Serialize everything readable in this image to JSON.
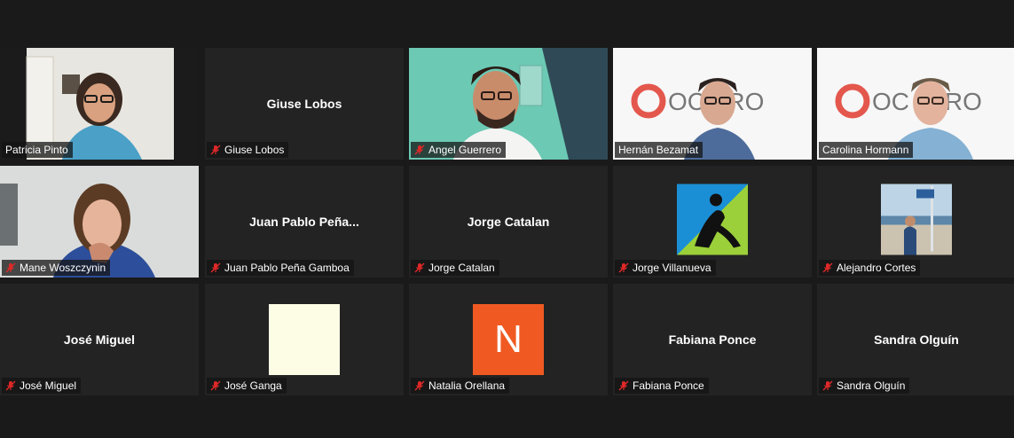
{
  "participants": [
    {
      "name": "Patricia Pinto",
      "muted": false,
      "display": "video"
    },
    {
      "name": "Giuse Lobos",
      "center": "Giuse Lobos",
      "muted": true
    },
    {
      "name": "Angel Guerrero",
      "muted": true,
      "display": "video"
    },
    {
      "name": "Hernán Bezamat",
      "muted": false,
      "display": "video",
      "banner": "OC TRO"
    },
    {
      "name": "Carolina Hormann",
      "muted": false,
      "display": "video",
      "banner": "OC ATRO"
    },
    {
      "name": "Mane Woszczynin",
      "muted": true,
      "display": "video"
    },
    {
      "name": "Juan Pablo Peña Gamboa",
      "center": "Juan Pablo Peña...",
      "muted": true
    },
    {
      "name": "Jorge Catalan",
      "center": "Jorge Catalan",
      "muted": true
    },
    {
      "name": "Jorge Villanueva",
      "muted": true,
      "display": "logo"
    },
    {
      "name": "Alejandro Cortes",
      "muted": true,
      "display": "photo"
    },
    {
      "name": "José Miguel",
      "center": "José Miguel",
      "muted": true
    },
    {
      "name": "José Ganga",
      "muted": true,
      "display": "blank"
    },
    {
      "name": "Natalia Orellana",
      "muted": true,
      "display": "letter",
      "letter": "N"
    },
    {
      "name": "Fabiana Ponce",
      "center": "Fabiana Ponce",
      "muted": true
    },
    {
      "name": "Sandra Olguín",
      "center": "Sandra Olguín",
      "muted": true
    }
  ],
  "colors": {
    "active_border": "#c5e56b",
    "mute_red": "#e02828",
    "tile_bg": "#232323"
  }
}
